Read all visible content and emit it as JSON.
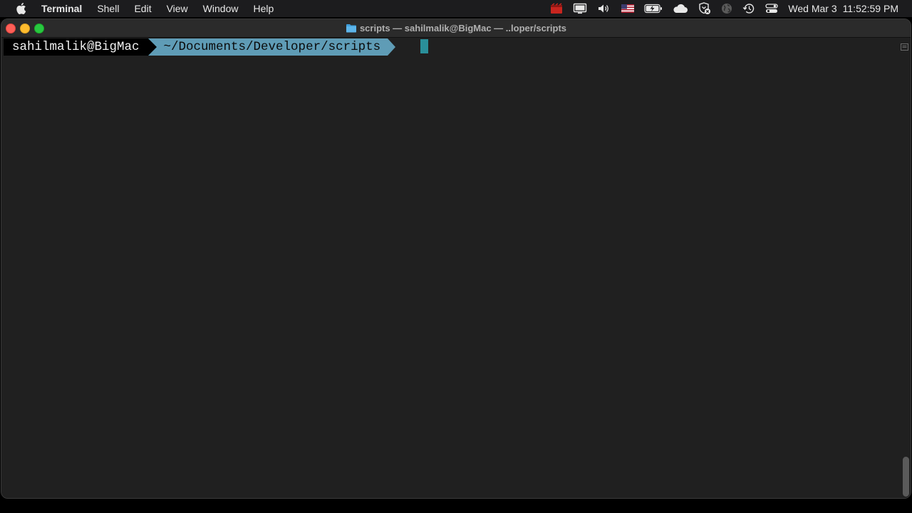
{
  "menubar": {
    "apple_icon": "apple-logo-icon",
    "app_name": "Terminal",
    "items": [
      "Shell",
      "Edit",
      "View",
      "Window",
      "Help"
    ],
    "status_icons": [
      "screen-recording-icon",
      "display-icon",
      "volume-icon",
      "us-flag-input-icon",
      "battery-charging-icon",
      "cloud-icon",
      "vpn-shield-icon",
      "globe-icon",
      "time-machine-icon",
      "control-center-icon"
    ],
    "date": "Wed Mar 3",
    "time": "11:52:59 PM"
  },
  "window": {
    "title": "scripts — sahilmalik@BigMac — ..loper/scripts",
    "title_icon": "folder-icon",
    "colors": {
      "background": "#202020",
      "path_segment": "#5f9cb6",
      "cursor": "#2a8f9a"
    }
  },
  "terminal": {
    "prompt_user": "sahilmalik@BigMac",
    "prompt_path": "~/Documents/Developer/scripts"
  }
}
